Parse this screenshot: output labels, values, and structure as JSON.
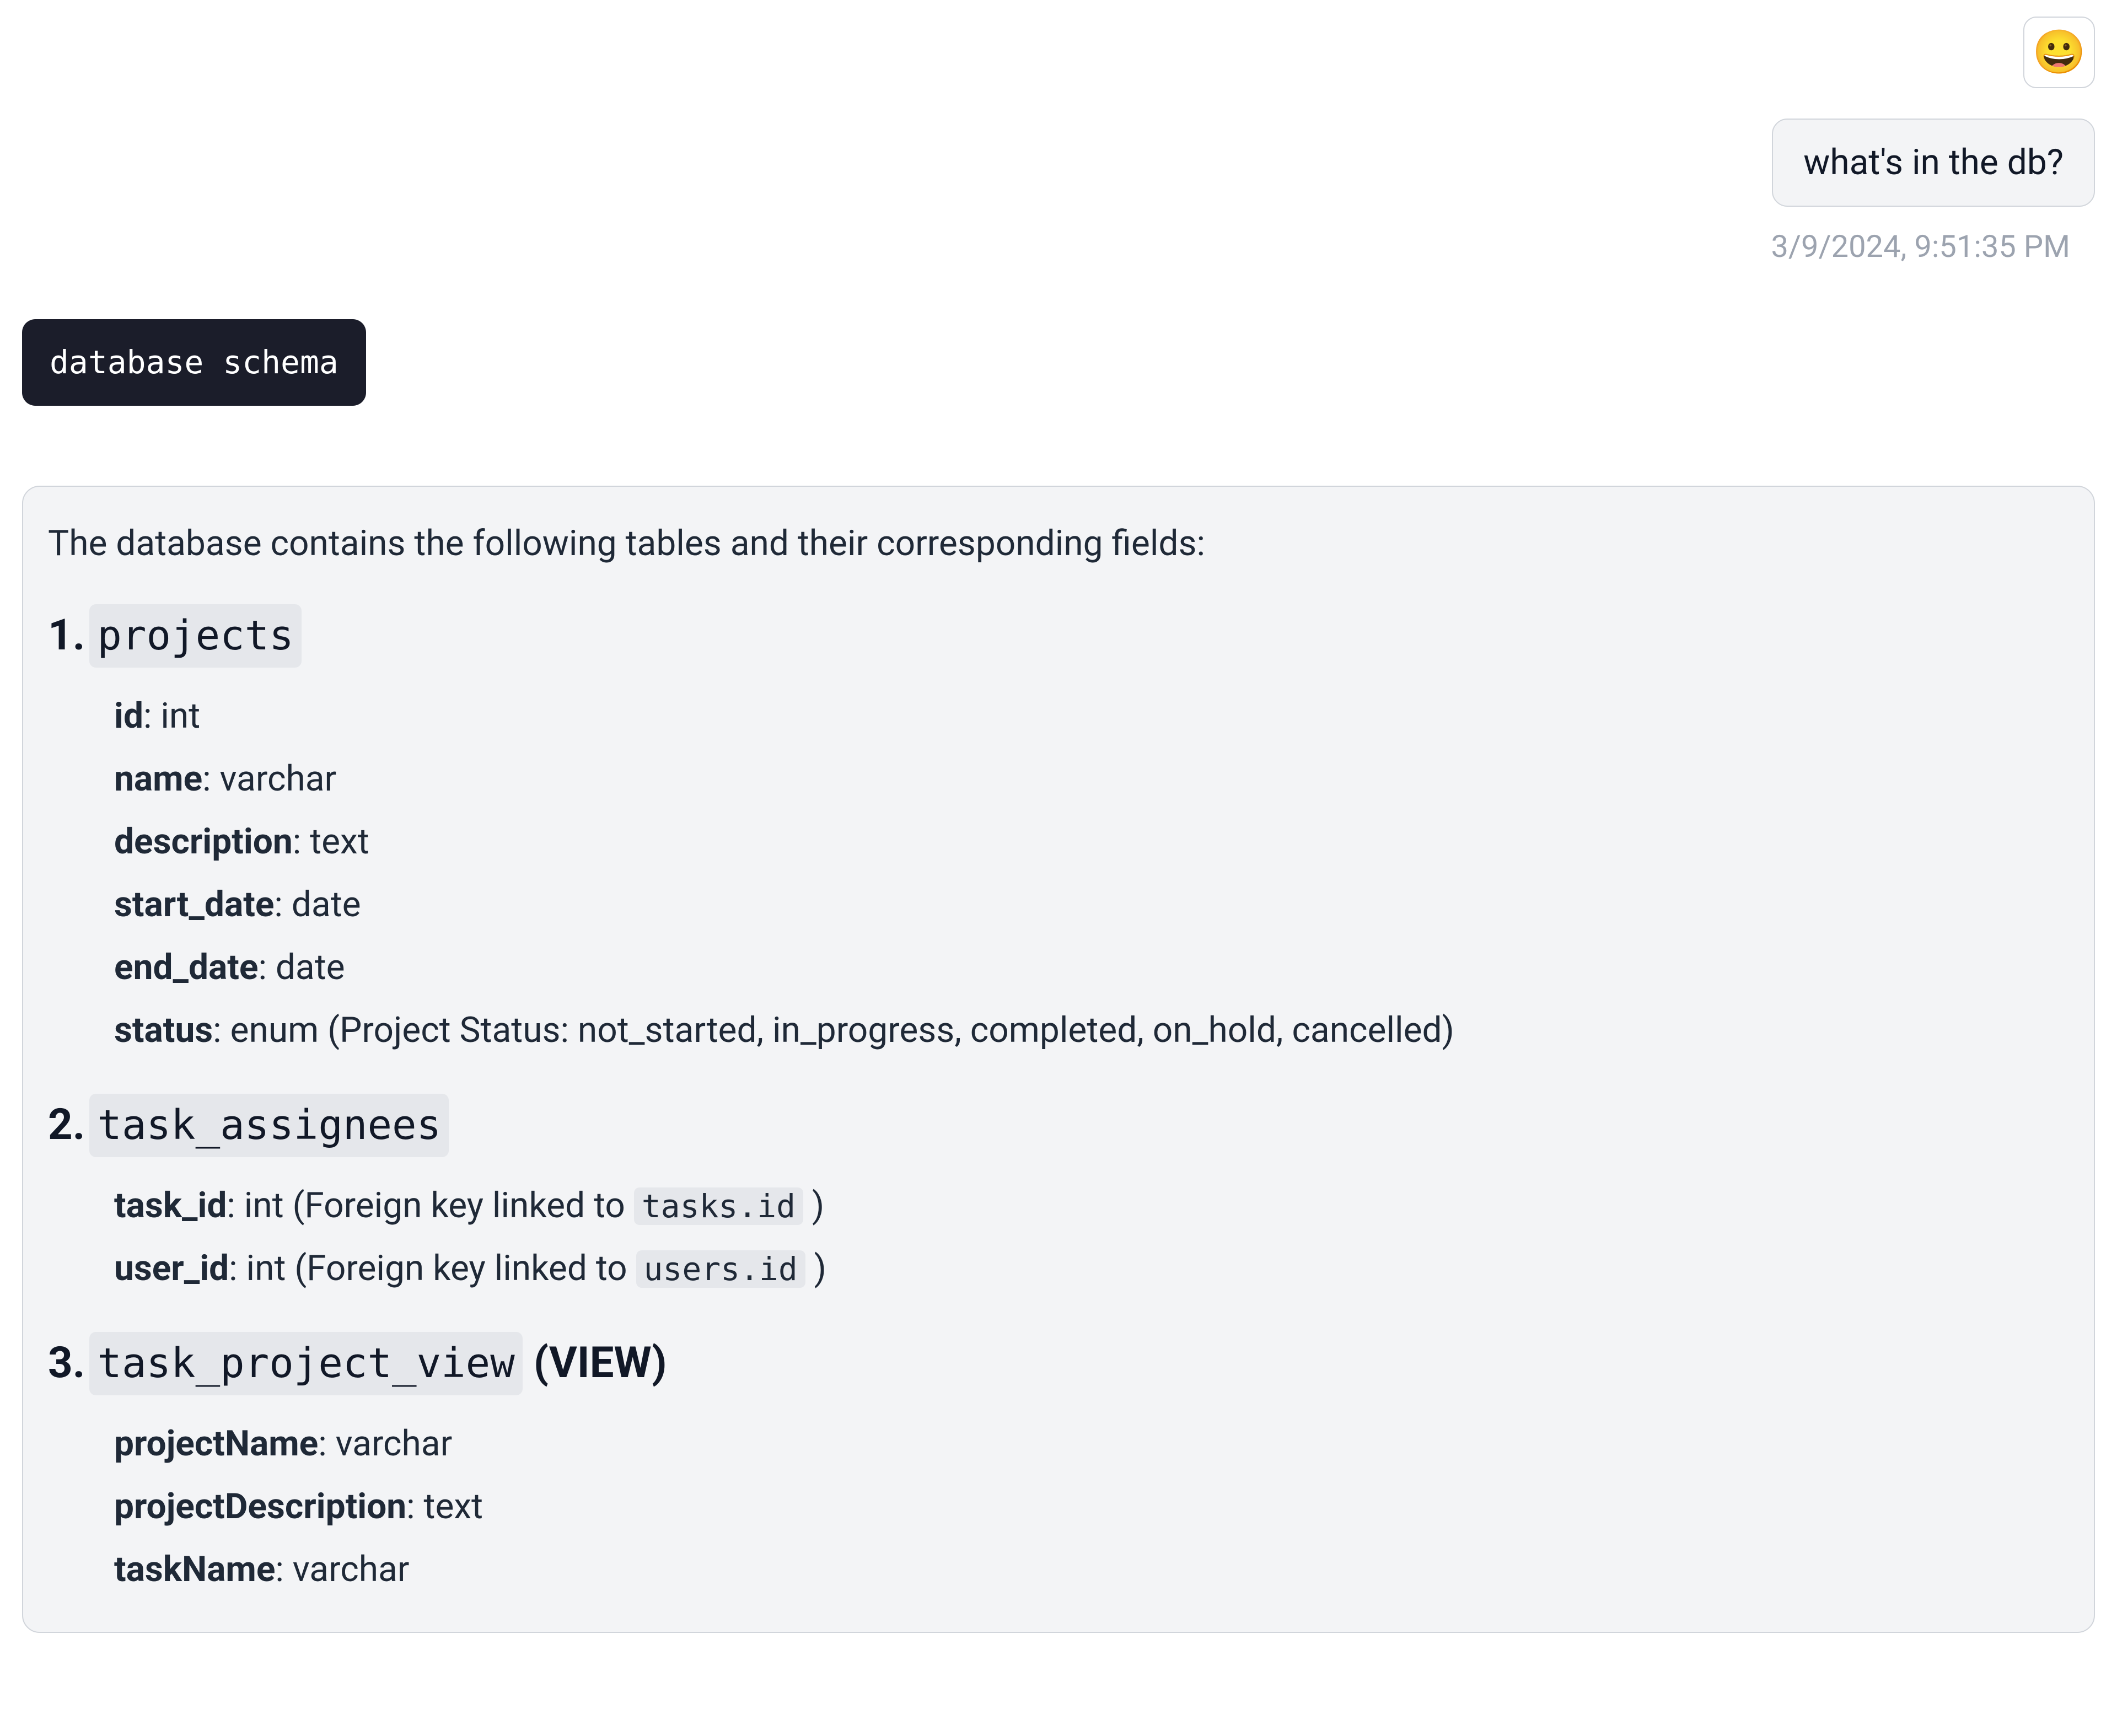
{
  "user": {
    "avatar": "😀",
    "message": "what's in the db?",
    "timestamp": "3/9/2024, 9:51:35 PM"
  },
  "tool_call": {
    "name": "database schema"
  },
  "assistant": {
    "intro": "The database contains the following tables and their corresponding fields:",
    "tables": [
      {
        "name": "projects",
        "suffix": "",
        "fields": [
          {
            "name": "id",
            "type_text": ": int"
          },
          {
            "name": "name",
            "type_text": ": varchar"
          },
          {
            "name": "description",
            "type_text": ": text"
          },
          {
            "name": "start_date",
            "type_text": ": date"
          },
          {
            "name": "end_date",
            "type_text": ": date"
          },
          {
            "name": "status",
            "type_text": ": enum (Project Status: not_started, in_progress, completed, on_hold, cancelled)"
          }
        ]
      },
      {
        "name": "task_assignees",
        "suffix": "",
        "fields": [
          {
            "name": "task_id",
            "type_prefix": ": int (Foreign key linked to ",
            "ref": "tasks.id",
            "type_suffix": " )"
          },
          {
            "name": "user_id",
            "type_prefix": ": int (Foreign key linked to ",
            "ref": "users.id",
            "type_suffix": " )"
          }
        ]
      },
      {
        "name": "task_project_view",
        "suffix": "(VIEW)",
        "fields": [
          {
            "name": "projectName",
            "type_text": ": varchar"
          },
          {
            "name": "projectDescription",
            "type_text": ": text"
          },
          {
            "name": "taskName",
            "type_text": ": varchar"
          }
        ]
      }
    ]
  }
}
